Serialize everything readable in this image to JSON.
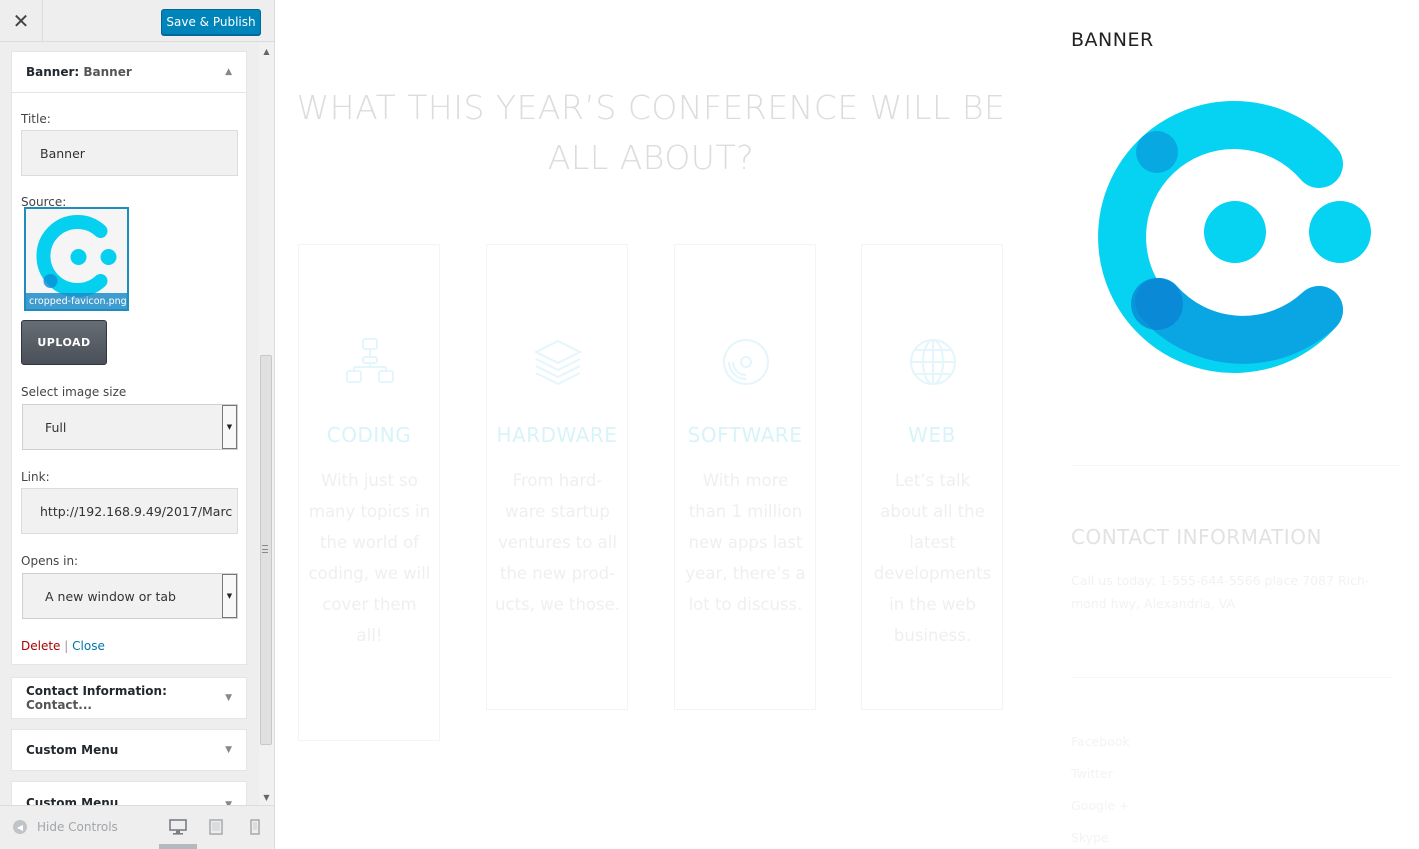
{
  "toolbar": {
    "close_glyph": "✕",
    "publish_label": "Save & Publish"
  },
  "banner_widget": {
    "header_name": "Banner:",
    "header_value": "Banner",
    "title_label": "Title:",
    "title_value": "Banner",
    "source_label": "Source:",
    "image_filename": "cropped-favicon.png",
    "upload_label": "UPLOAD",
    "size_label": "Select image size",
    "size_value": "Full",
    "link_label": "Link:",
    "link_value": "http://192.168.9.49/2017/Marc",
    "opens_label": "Opens in:",
    "opens_value": "A new window or tab",
    "delete_label": "Delete",
    "separator": "|",
    "close_label": "Close"
  },
  "collapsed_widgets": [
    {
      "name": "Contact Information:",
      "value": "Contact..."
    },
    {
      "name": "Custom Menu",
      "value": ""
    },
    {
      "name": "Custom Menu",
      "value": ""
    }
  ],
  "footer": {
    "hide_controls_label": "Hide Controls",
    "devices": [
      "desktop-icon",
      "tablet-icon",
      "mobile-icon"
    ]
  },
  "preview": {
    "heading": "WHAT THIS YEAR’S CONFERENCE WILL BE ALL ABOUT?",
    "cards": [
      {
        "title": "CODING",
        "icon": "sitemap-icon",
        "text": "With just so many topics in the world of coding, we will cover them all!"
      },
      {
        "title": "HARDWARE",
        "icon": "layers-icon",
        "text": "From hard-ware startup ventures to all the new prod-ucts, we those."
      },
      {
        "title": "SOFTWARE",
        "icon": "disc-icon",
        "text": "With more than 1 million new apps last year, there’s a lot to discuss."
      },
      {
        "title": "WEB",
        "icon": "globe-icon",
        "text": "Let’s talk about all the latest developments in the web business."
      }
    ],
    "banner_title": "BANNER",
    "contact_title": "CONTACT INFORMATION",
    "contact_text": "Call us today: 1-555-644-5566 place 7087 Rich-mond hwy, Alexandria, VA",
    "social_links": [
      "Facebook",
      "Twitter",
      "Google +",
      "Skype"
    ]
  },
  "colors": {
    "accent": "#0085ba",
    "logo_cyan": "#00d2f0",
    "logo_blue": "#0aa8e6"
  }
}
